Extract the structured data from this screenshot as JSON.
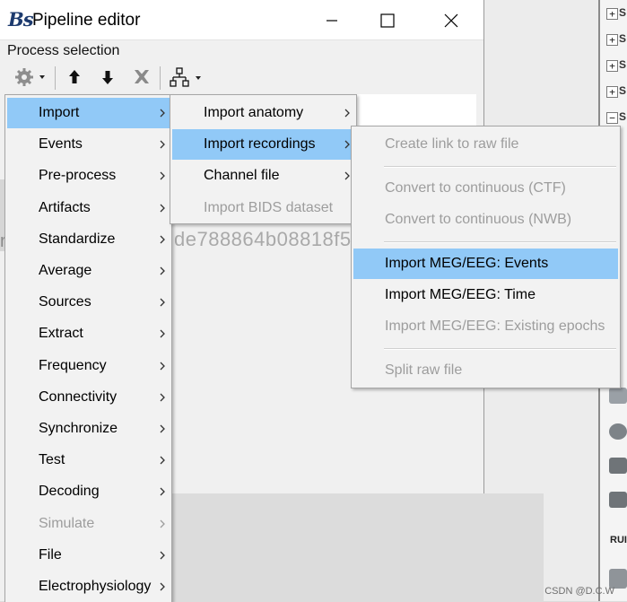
{
  "window": {
    "title": "Pipeline editor",
    "logo_text": "Bs",
    "section_label": "Process selection"
  },
  "toolbar": {
    "buttons": [
      {
        "icon": "gear-icon",
        "has_dropdown": true
      },
      {
        "icon": "arrow-up-icon"
      },
      {
        "icon": "arrow-down-icon"
      },
      {
        "icon": "delete-x-icon"
      },
      {
        "icon": "pipeline-tree-icon",
        "has_dropdown": true
      }
    ]
  },
  "background": {
    "hash_fragment": "de788864b08818f5",
    "left_strip_mark": "r",
    "run_label": "RUI",
    "tree_label": "S",
    "watermark": "CSDN @D.C.W"
  },
  "menu_main": {
    "items": [
      {
        "label": "Import",
        "highlighted": true,
        "disabled": false
      },
      {
        "label": "Events",
        "highlighted": false,
        "disabled": false
      },
      {
        "label": "Pre-process",
        "highlighted": false,
        "disabled": false
      },
      {
        "label": "Artifacts",
        "highlighted": false,
        "disabled": false
      },
      {
        "label": "Standardize",
        "highlighted": false,
        "disabled": false
      },
      {
        "label": "Average",
        "highlighted": false,
        "disabled": false
      },
      {
        "label": "Sources",
        "highlighted": false,
        "disabled": false
      },
      {
        "label": "Extract",
        "highlighted": false,
        "disabled": false
      },
      {
        "label": "Frequency",
        "highlighted": false,
        "disabled": false
      },
      {
        "label": "Connectivity",
        "highlighted": false,
        "disabled": false
      },
      {
        "label": "Synchronize",
        "highlighted": false,
        "disabled": false
      },
      {
        "label": "Test",
        "highlighted": false,
        "disabled": false
      },
      {
        "label": "Decoding",
        "highlighted": false,
        "disabled": false
      },
      {
        "label": "Simulate",
        "highlighted": false,
        "disabled": true
      },
      {
        "label": "File",
        "highlighted": false,
        "disabled": false
      },
      {
        "label": "Electrophysiology",
        "highlighted": false,
        "disabled": false
      }
    ]
  },
  "menu_import": {
    "items": [
      {
        "label": "Import anatomy",
        "highlighted": false,
        "disabled": false,
        "submenu": true
      },
      {
        "label": "Import recordings",
        "highlighted": true,
        "disabled": false,
        "submenu": true
      },
      {
        "label": "Channel file",
        "highlighted": false,
        "disabled": false,
        "submenu": true
      },
      {
        "label": "Import BIDS dataset",
        "highlighted": false,
        "disabled": true,
        "submenu": false
      }
    ]
  },
  "menu_recordings": {
    "items": [
      {
        "label": "Create link to raw file",
        "highlighted": false,
        "disabled": true
      },
      {
        "separator": true
      },
      {
        "label": "Convert to continuous (CTF)",
        "highlighted": false,
        "disabled": true
      },
      {
        "label": "Convert to continuous (NWB)",
        "highlighted": false,
        "disabled": true
      },
      {
        "separator": true
      },
      {
        "label": "Import MEG/EEG: Events",
        "highlighted": true,
        "disabled": false
      },
      {
        "label": "Import MEG/EEG: Time",
        "highlighted": false,
        "disabled": false
      },
      {
        "label": "Import MEG/EEG: Existing epochs",
        "highlighted": false,
        "disabled": true
      },
      {
        "separator": true
      },
      {
        "label": "Split raw file",
        "highlighted": false,
        "disabled": true
      }
    ]
  },
  "colors": {
    "highlight": "#91c9f7",
    "disabled_text": "#9d9d9d",
    "menu_bg": "#f2f2f2"
  }
}
